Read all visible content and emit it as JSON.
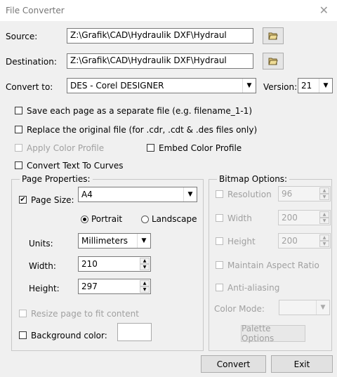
{
  "window": {
    "title": "File Converter",
    "close": "✕"
  },
  "source": {
    "label": "Source:",
    "value": "Z:\\Grafik\\CAD\\Hydraulik DXF\\Hydraul"
  },
  "destination": {
    "label": "Destination:",
    "value": "Z:\\Grafik\\CAD\\Hydraulik DXF\\Hydraul"
  },
  "convert_to": {
    "label": "Convert to:",
    "value": "DES - Corel DESIGNER"
  },
  "version": {
    "label": "Version:",
    "value": "21"
  },
  "options": {
    "save_each_page": "Save each page as a separate file (e.g. filename_1-1)",
    "replace_original": "Replace the original file (for .cdr, .cdt & .des files only)",
    "apply_color_profile": "Apply Color Profile",
    "embed_color_profile": "Embed Color Profile",
    "convert_text": "Convert Text To Curves"
  },
  "page_props": {
    "title": "Page Properties:",
    "page_size_label": "Page Size:",
    "page_size_value": "A4",
    "page_size_checked": "✔",
    "portrait": "Portrait",
    "landscape": "Landscape",
    "units_label": "Units:",
    "units_value": "Millimeters",
    "width_label": "Width:",
    "width_value": "210",
    "height_label": "Height:",
    "height_value": "297",
    "resize_label": "Resize page to fit content",
    "bg_label": "Background color:"
  },
  "bitmap": {
    "title": "Bitmap Options:",
    "resolution_label": "Resolution",
    "resolution_value": "96",
    "width_label": "Width",
    "width_value": "200",
    "height_label": "Height",
    "height_value": "200",
    "aspect_label": "Maintain Aspect Ratio",
    "antialias_label": "Anti-aliasing",
    "color_mode_label": "Color Mode:",
    "palette_button": "Palette Options"
  },
  "buttons": {
    "convert": "Convert",
    "exit": "Exit"
  }
}
